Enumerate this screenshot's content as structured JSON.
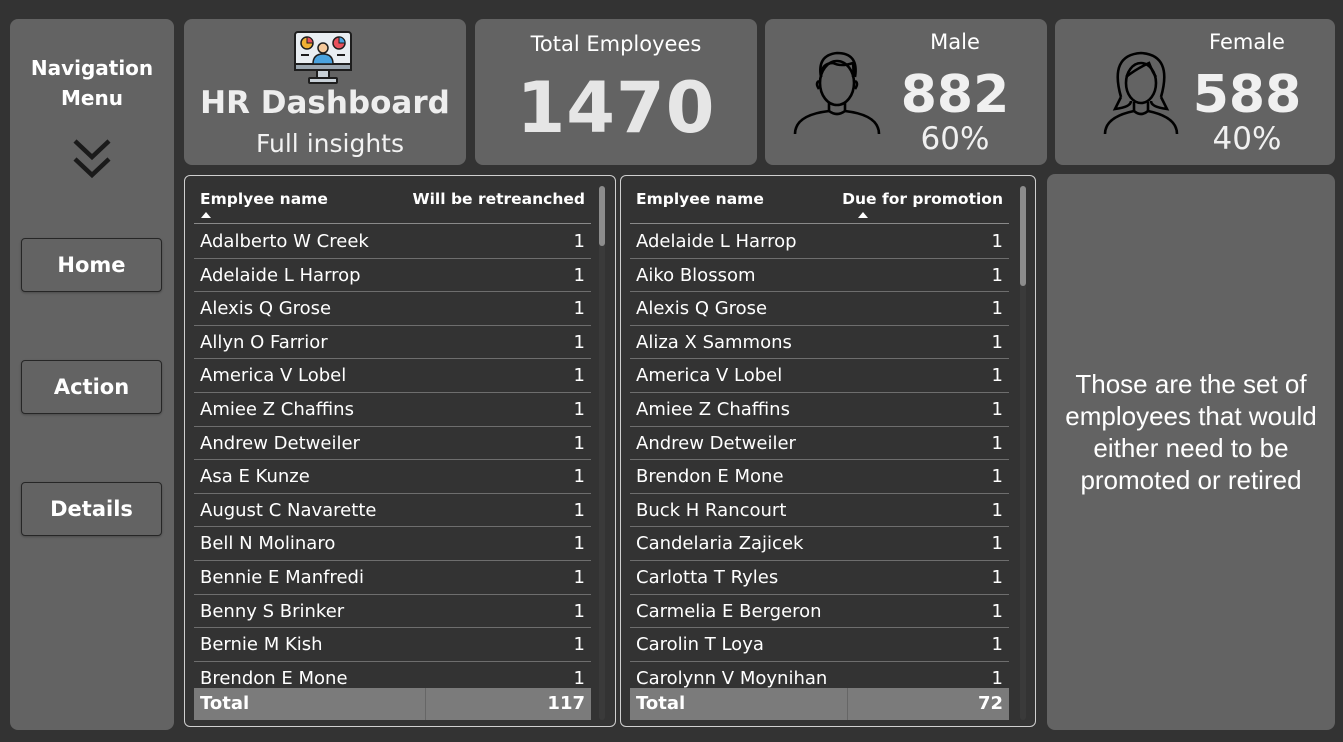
{
  "nav": {
    "title_line1": "Navigation",
    "title_line2": "Menu",
    "buttons": [
      "Home",
      "Action",
      "Details"
    ]
  },
  "header": {
    "title": "HR Dashboard",
    "subtitle": "Full insights",
    "icon": "monitor-analytics-icon"
  },
  "total": {
    "label": "Total Employees",
    "value": "1470"
  },
  "male": {
    "label": "Male",
    "count": "882",
    "percent": "60%",
    "icon": "male-person-icon"
  },
  "female": {
    "label": "Female",
    "count": "588",
    "percent": "40%",
    "icon": "female-person-icon"
  },
  "retrench_table": {
    "col_name": "Emplyee name",
    "col_value": "Will be retreanched",
    "rows": [
      [
        "Adalberto W Creek",
        "1"
      ],
      [
        "Adelaide L Harrop",
        "1"
      ],
      [
        "Alexis Q Grose",
        "1"
      ],
      [
        "Allyn O Farrior",
        "1"
      ],
      [
        "America V Lobel",
        "1"
      ],
      [
        "Amiee Z Chaffins",
        "1"
      ],
      [
        "Andrew Detweiler",
        "1"
      ],
      [
        "Asa E Kunze",
        "1"
      ],
      [
        "August C Navarette",
        "1"
      ],
      [
        "Bell N Molinaro",
        "1"
      ],
      [
        "Bennie E Manfredi",
        "1"
      ],
      [
        "Benny S Brinker",
        "1"
      ],
      [
        "Bernie M Kish",
        "1"
      ],
      [
        "Brendon E Mone",
        "1"
      ]
    ],
    "total_label": "Total",
    "total_value": "117"
  },
  "promotion_table": {
    "col_name": "Emplyee name",
    "col_value": "Due for promotion",
    "rows": [
      [
        "Adelaide L Harrop",
        "1"
      ],
      [
        "Aiko Blossom",
        "1"
      ],
      [
        "Alexis Q Grose",
        "1"
      ],
      [
        "Aliza X Sammons",
        "1"
      ],
      [
        "America V Lobel",
        "1"
      ],
      [
        "Amiee Z Chaffins",
        "1"
      ],
      [
        "Andrew Detweiler",
        "1"
      ],
      [
        "Brendon E Mone",
        "1"
      ],
      [
        "Buck H Rancourt",
        "1"
      ],
      [
        "Candelaria Zajicek",
        "1"
      ],
      [
        "Carlotta T Ryles",
        "1"
      ],
      [
        "Carmelia E Bergeron",
        "1"
      ],
      [
        "Carolin T Loya",
        "1"
      ],
      [
        "Carolynn V Moynihan",
        "1"
      ]
    ],
    "total_label": "Total",
    "total_value": "72"
  },
  "info": {
    "line1": "Those are the set of",
    "line2": "employees that would",
    "line3": "either need to be",
    "line4": "promoted or retired"
  }
}
